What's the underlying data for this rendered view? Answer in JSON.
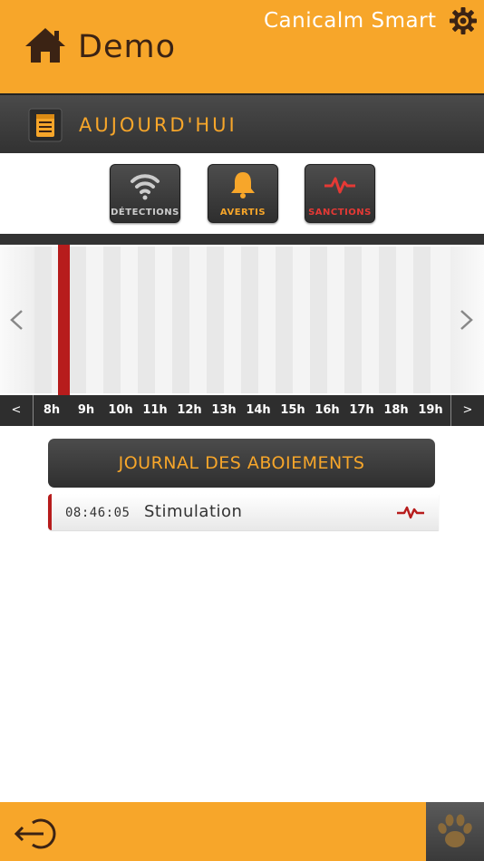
{
  "header": {
    "title": "Demo",
    "brand": "Canicalm Smart",
    "home_icon": "home-icon",
    "settings_icon": "gear-icon"
  },
  "today_bar": {
    "label": "AUJOURD'HUI",
    "icon": "calendar-icon"
  },
  "filters": [
    {
      "label": "DÉTECTIONS",
      "icon": "wifi-icon",
      "color": "#cccccc"
    },
    {
      "label": "AVERTIS",
      "icon": "bell-icon",
      "color": "#f7a62a"
    },
    {
      "label": "SANCTIONS",
      "icon": "pulse-icon",
      "color": "#e53935"
    }
  ],
  "timeline": {
    "hours": [
      "8h",
      "9h",
      "10h",
      "11h",
      "12h",
      "13h",
      "14h",
      "15h",
      "16h",
      "17h",
      "18h",
      "19h"
    ],
    "prev_label": "<",
    "next_label": ">",
    "marker_color": "#b71c1c"
  },
  "journal": {
    "title": "JOURNAL DES ABOIEMENTS",
    "entries": [
      {
        "time": "08:46:05",
        "event": "Stimulation",
        "icon": "pulse-icon"
      }
    ]
  },
  "footer": {
    "logout_icon": "logout-icon",
    "paw_icon": "paw-icon"
  },
  "colors": {
    "accent": "#f7a62a",
    "dark": "#333333",
    "sanction": "#b71c1c"
  }
}
